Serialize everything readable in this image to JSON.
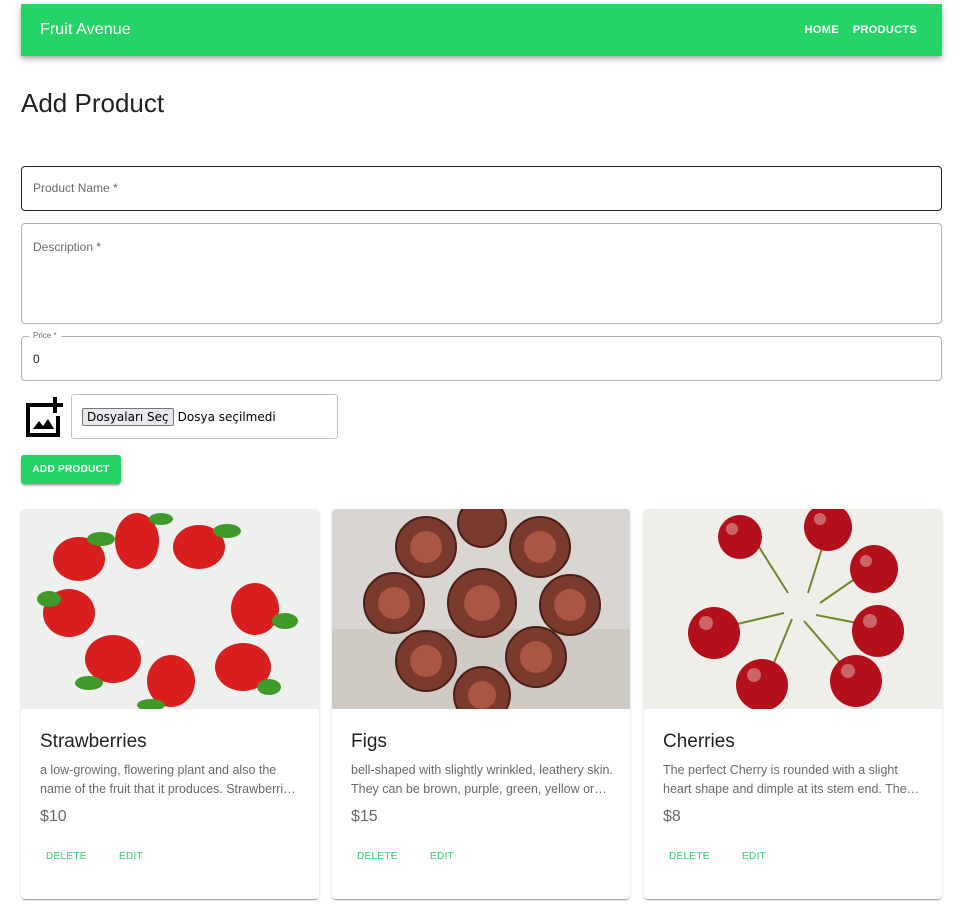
{
  "header": {
    "brand": "Fruit Avenue",
    "nav": [
      "HOME",
      "PRODUCTS"
    ],
    "color": "#25d366"
  },
  "page": {
    "title": "Add Product"
  },
  "form": {
    "name_label": "Product Name *",
    "description_label": "Description *",
    "price_label": "Price *",
    "price_value": "0",
    "file_button": "Dosyaları Seç",
    "file_status": "Dosya seçilmedi",
    "submit_label": "ADD PRODUCT",
    "upload_icon": "add-photo-icon"
  },
  "products": [
    {
      "title": "Strawberries",
      "description": "a low-growing, flowering plant and also the name of the fruit that it produces. Strawberries are soft, sweet, bright red berries.",
      "price": "$10",
      "delete_label": "DELETE",
      "edit_label": "EDIT"
    },
    {
      "title": "Figs",
      "description": "bell-shaped with slightly wrinkled, leathery skin. They can be brown, purple, green, yellow or black.",
      "price": "$15",
      "delete_label": "DELETE",
      "edit_label": "EDIT"
    },
    {
      "title": "Cherries",
      "description": "The perfect Cherry is rounded with a slight heart shape and dimple at its stem end. The skin is glossy.",
      "price": "$8",
      "delete_label": "DELETE",
      "edit_label": "EDIT"
    }
  ]
}
